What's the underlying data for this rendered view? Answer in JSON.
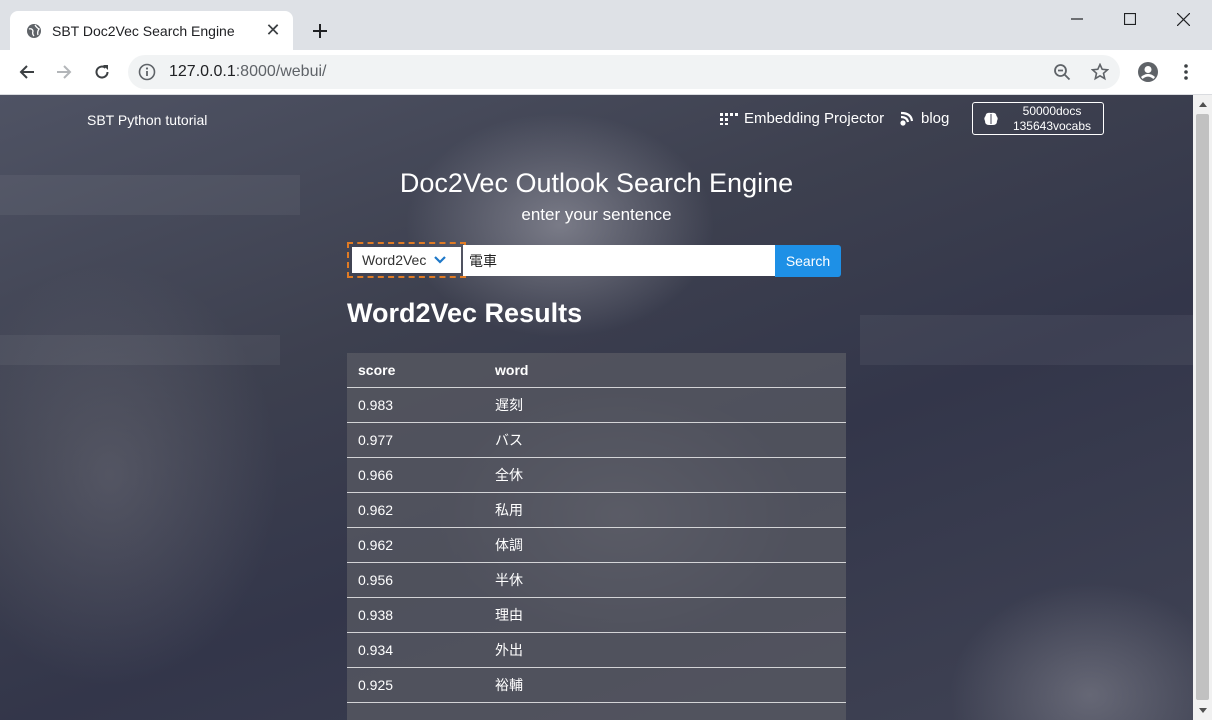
{
  "browser": {
    "tab_title": "SBT Doc2Vec Search Engine",
    "url_host": "127.0.0.1",
    "url_path": ":8000/webui/"
  },
  "nav": {
    "brand": "SBT Python tutorial",
    "projector_label": "Embedding Projector",
    "blog_label": "blog",
    "stats_docs": "50000docs",
    "stats_vocabs": "135643vocabs"
  },
  "hero": {
    "title": "Doc2Vec Outlook Search Engine",
    "subtitle": "enter your sentence"
  },
  "search": {
    "mode": "Word2Vec",
    "query": "電車",
    "button_label": "Search"
  },
  "results": {
    "title": "Word2Vec Results",
    "headers": [
      "score",
      "word"
    ],
    "rows": [
      {
        "score": "0.983",
        "word": "遅刻"
      },
      {
        "score": "0.977",
        "word": "バス"
      },
      {
        "score": "0.966",
        "word": "全休"
      },
      {
        "score": "0.962",
        "word": "私用"
      },
      {
        "score": "0.962",
        "word": "体調"
      },
      {
        "score": "0.956",
        "word": "半休"
      },
      {
        "score": "0.938",
        "word": "理由"
      },
      {
        "score": "0.934",
        "word": "外出"
      },
      {
        "score": "0.925",
        "word": "裕輔"
      }
    ]
  },
  "colors": {
    "accent": "#1e90e6",
    "focus_outline": "#e07b24"
  }
}
